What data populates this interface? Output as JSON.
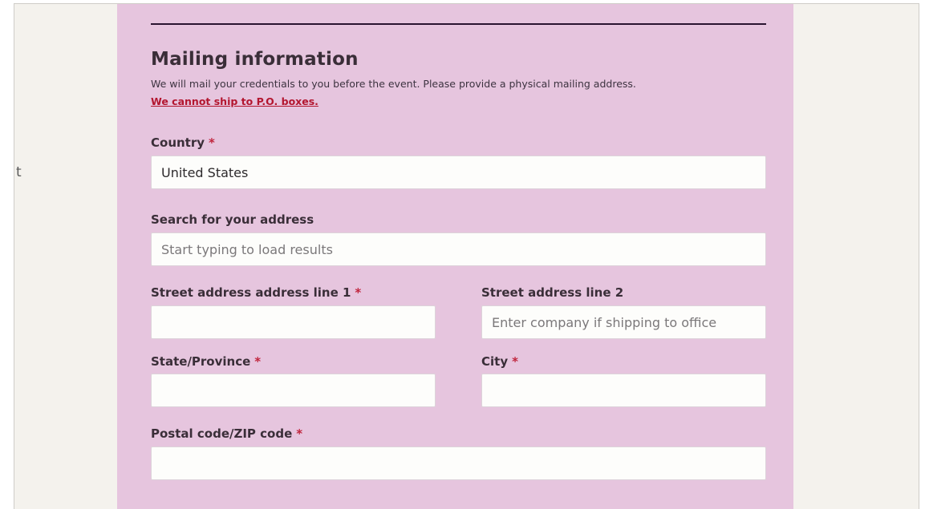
{
  "side_fragment": "t",
  "mailing": {
    "title": "Mailing information",
    "description": "We will mail your credentials to you before the event. Please provide a physical mailing address.",
    "warning": "We cannot ship to P.O. boxes."
  },
  "required_marker": "*",
  "fields": {
    "country": {
      "label": "Country",
      "value": "United States"
    },
    "search": {
      "label": "Search for your address",
      "placeholder": "Start typing to load results"
    },
    "street1": {
      "label": "Street address address line 1",
      "value": ""
    },
    "street2": {
      "label": "Street address line 2",
      "placeholder": "Enter company if shipping to office"
    },
    "state": {
      "label": "State/Province",
      "value": ""
    },
    "city": {
      "label": "City",
      "value": ""
    },
    "postal": {
      "label": "Postal code/ZIP code",
      "value": ""
    }
  },
  "colors": {
    "panel_background": "#e6c5de",
    "page_background": "#f4f2ed",
    "required_marker": "#c0253d",
    "warning_link": "#b3162f"
  }
}
